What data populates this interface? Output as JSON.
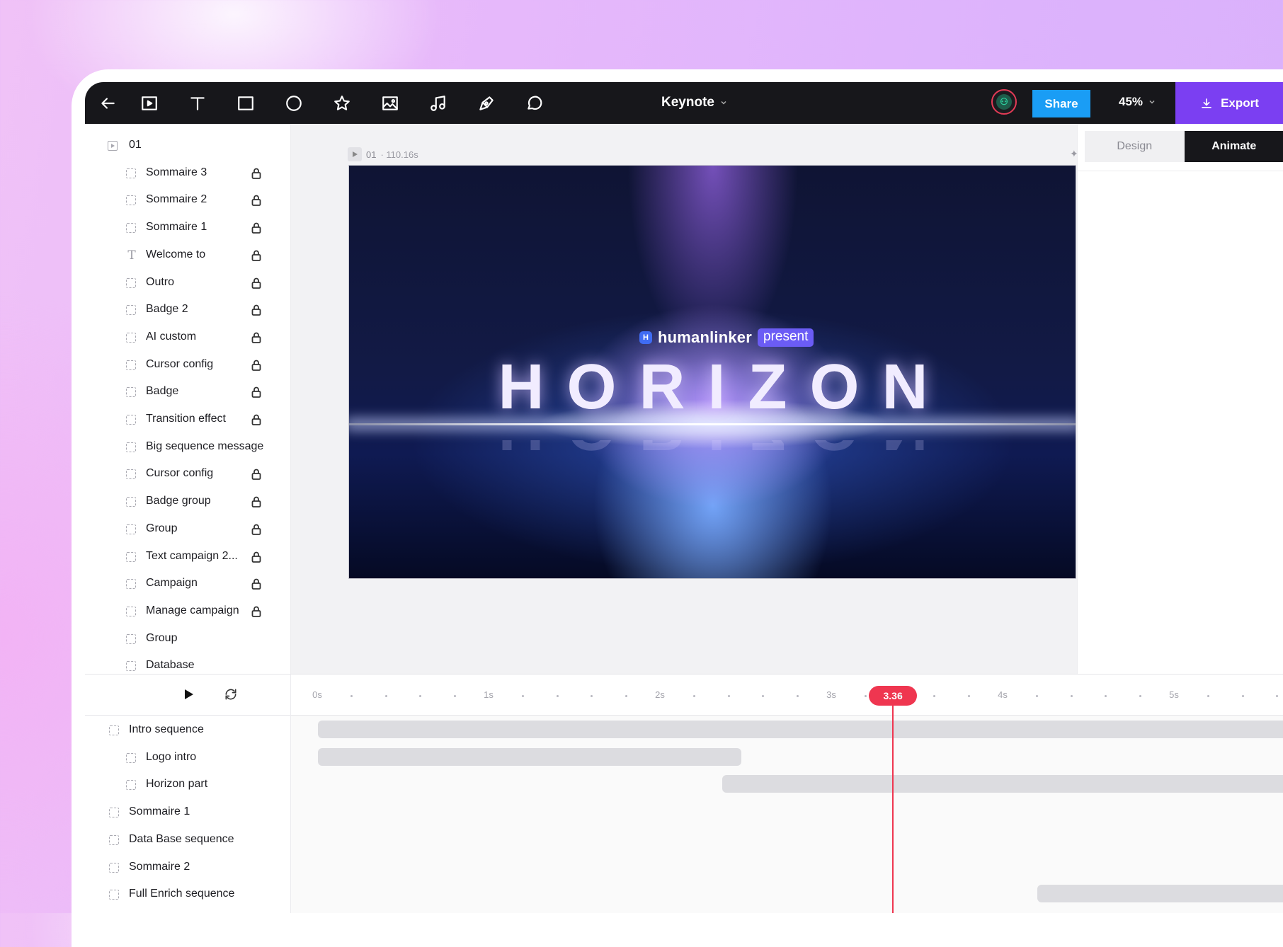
{
  "topbar": {
    "title": "Keynote",
    "share_label": "Share",
    "zoom": "45%",
    "export_label": "Export",
    "tools": [
      "back-arrow-icon",
      "frame-play-icon",
      "text-tool-icon",
      "rectangle-tool-icon",
      "ellipse-tool-icon",
      "star-tool-icon",
      "image-tool-icon",
      "music-tool-icon",
      "pen-tool-icon",
      "comment-tool-icon"
    ]
  },
  "layers": {
    "root": "01",
    "items": [
      {
        "label": "Sommaire 3",
        "locked": true,
        "type": "frame"
      },
      {
        "label": "Sommaire 2",
        "locked": true,
        "type": "frame"
      },
      {
        "label": "Sommaire 1",
        "locked": true,
        "type": "frame"
      },
      {
        "label": "Welcome to",
        "locked": true,
        "type": "text"
      },
      {
        "label": "Outro",
        "locked": true,
        "type": "frame"
      },
      {
        "label": "Badge 2",
        "locked": true,
        "type": "frame"
      },
      {
        "label": "AI custom",
        "locked": true,
        "type": "frame"
      },
      {
        "label": "Cursor config",
        "locked": true,
        "type": "frame"
      },
      {
        "label": "Badge",
        "locked": true,
        "type": "frame"
      },
      {
        "label": "Transition effect",
        "locked": true,
        "type": "frame"
      },
      {
        "label": "Big sequence message",
        "locked": false,
        "type": "frame"
      },
      {
        "label": "Cursor config",
        "locked": true,
        "type": "frame"
      },
      {
        "label": "Badge group",
        "locked": true,
        "type": "frame"
      },
      {
        "label": "Group",
        "locked": true,
        "type": "frame"
      },
      {
        "label": "Text campaign 2...",
        "locked": true,
        "type": "frame"
      },
      {
        "label": "Campaign",
        "locked": true,
        "type": "frame"
      },
      {
        "label": "Manage campaign",
        "locked": true,
        "type": "frame"
      },
      {
        "label": "Group",
        "locked": false,
        "type": "frame"
      },
      {
        "label": "Database",
        "locked": false,
        "type": "frame"
      }
    ]
  },
  "canvas": {
    "slide_name": "01",
    "slide_duration": "· 110.16s",
    "brand_name": "humanlinker",
    "brand_tag": "present",
    "headline": "HORIZON"
  },
  "right_panel": {
    "tabs": [
      "Design",
      "Animate"
    ],
    "active_tab": "Animate"
  },
  "timeline": {
    "ticks": [
      "0s",
      "1s",
      "2s",
      "3s",
      "4s",
      "5s"
    ],
    "playhead": "3.36",
    "playhead_seconds": 3.36,
    "sequences": [
      {
        "label": "Intro sequence",
        "indent": 0,
        "start": 0.0,
        "end": null
      },
      {
        "label": "Logo intro",
        "indent": 1,
        "start": 0.0,
        "end": 2.47
      },
      {
        "label": "Horizon part",
        "indent": 1,
        "start": 2.36,
        "end": null
      },
      {
        "label": "Sommaire 1",
        "indent": 0,
        "start": null,
        "end": null
      },
      {
        "label": "Data Base sequence",
        "indent": 0,
        "start": null,
        "end": null
      },
      {
        "label": "Sommaire 2",
        "indent": 0,
        "start": null,
        "end": null
      },
      {
        "label": "Full Enrich sequence",
        "indent": 0,
        "start": 4.2,
        "end": null
      }
    ]
  },
  "colors": {
    "export": "#7b3ff2",
    "share": "#1a9df5",
    "playhead": "#ef3650",
    "topbar": "#17171b"
  }
}
